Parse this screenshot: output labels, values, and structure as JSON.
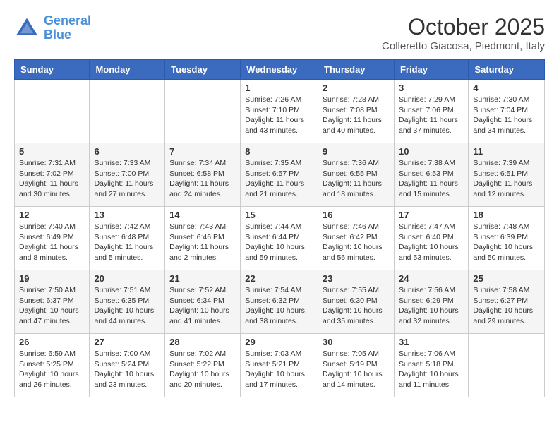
{
  "header": {
    "logo_line1": "General",
    "logo_line2": "Blue",
    "title": "October 2025",
    "subtitle": "Colleretto Giacosa, Piedmont, Italy"
  },
  "weekdays": [
    "Sunday",
    "Monday",
    "Tuesday",
    "Wednesday",
    "Thursday",
    "Friday",
    "Saturday"
  ],
  "weeks": [
    [
      {
        "day": "",
        "info": ""
      },
      {
        "day": "",
        "info": ""
      },
      {
        "day": "",
        "info": ""
      },
      {
        "day": "1",
        "info": "Sunrise: 7:26 AM\nSunset: 7:10 PM\nDaylight: 11 hours\nand 43 minutes."
      },
      {
        "day": "2",
        "info": "Sunrise: 7:28 AM\nSunset: 7:08 PM\nDaylight: 11 hours\nand 40 minutes."
      },
      {
        "day": "3",
        "info": "Sunrise: 7:29 AM\nSunset: 7:06 PM\nDaylight: 11 hours\nand 37 minutes."
      },
      {
        "day": "4",
        "info": "Sunrise: 7:30 AM\nSunset: 7:04 PM\nDaylight: 11 hours\nand 34 minutes."
      }
    ],
    [
      {
        "day": "5",
        "info": "Sunrise: 7:31 AM\nSunset: 7:02 PM\nDaylight: 11 hours\nand 30 minutes."
      },
      {
        "day": "6",
        "info": "Sunrise: 7:33 AM\nSunset: 7:00 PM\nDaylight: 11 hours\nand 27 minutes."
      },
      {
        "day": "7",
        "info": "Sunrise: 7:34 AM\nSunset: 6:58 PM\nDaylight: 11 hours\nand 24 minutes."
      },
      {
        "day": "8",
        "info": "Sunrise: 7:35 AM\nSunset: 6:57 PM\nDaylight: 11 hours\nand 21 minutes."
      },
      {
        "day": "9",
        "info": "Sunrise: 7:36 AM\nSunset: 6:55 PM\nDaylight: 11 hours\nand 18 minutes."
      },
      {
        "day": "10",
        "info": "Sunrise: 7:38 AM\nSunset: 6:53 PM\nDaylight: 11 hours\nand 15 minutes."
      },
      {
        "day": "11",
        "info": "Sunrise: 7:39 AM\nSunset: 6:51 PM\nDaylight: 11 hours\nand 12 minutes."
      }
    ],
    [
      {
        "day": "12",
        "info": "Sunrise: 7:40 AM\nSunset: 6:49 PM\nDaylight: 11 hours\nand 8 minutes."
      },
      {
        "day": "13",
        "info": "Sunrise: 7:42 AM\nSunset: 6:48 PM\nDaylight: 11 hours\nand 5 minutes."
      },
      {
        "day": "14",
        "info": "Sunrise: 7:43 AM\nSunset: 6:46 PM\nDaylight: 11 hours\nand 2 minutes."
      },
      {
        "day": "15",
        "info": "Sunrise: 7:44 AM\nSunset: 6:44 PM\nDaylight: 10 hours\nand 59 minutes."
      },
      {
        "day": "16",
        "info": "Sunrise: 7:46 AM\nSunset: 6:42 PM\nDaylight: 10 hours\nand 56 minutes."
      },
      {
        "day": "17",
        "info": "Sunrise: 7:47 AM\nSunset: 6:40 PM\nDaylight: 10 hours\nand 53 minutes."
      },
      {
        "day": "18",
        "info": "Sunrise: 7:48 AM\nSunset: 6:39 PM\nDaylight: 10 hours\nand 50 minutes."
      }
    ],
    [
      {
        "day": "19",
        "info": "Sunrise: 7:50 AM\nSunset: 6:37 PM\nDaylight: 10 hours\nand 47 minutes."
      },
      {
        "day": "20",
        "info": "Sunrise: 7:51 AM\nSunset: 6:35 PM\nDaylight: 10 hours\nand 44 minutes."
      },
      {
        "day": "21",
        "info": "Sunrise: 7:52 AM\nSunset: 6:34 PM\nDaylight: 10 hours\nand 41 minutes."
      },
      {
        "day": "22",
        "info": "Sunrise: 7:54 AM\nSunset: 6:32 PM\nDaylight: 10 hours\nand 38 minutes."
      },
      {
        "day": "23",
        "info": "Sunrise: 7:55 AM\nSunset: 6:30 PM\nDaylight: 10 hours\nand 35 minutes."
      },
      {
        "day": "24",
        "info": "Sunrise: 7:56 AM\nSunset: 6:29 PM\nDaylight: 10 hours\nand 32 minutes."
      },
      {
        "day": "25",
        "info": "Sunrise: 7:58 AM\nSunset: 6:27 PM\nDaylight: 10 hours\nand 29 minutes."
      }
    ],
    [
      {
        "day": "26",
        "info": "Sunrise: 6:59 AM\nSunset: 5:25 PM\nDaylight: 10 hours\nand 26 minutes."
      },
      {
        "day": "27",
        "info": "Sunrise: 7:00 AM\nSunset: 5:24 PM\nDaylight: 10 hours\nand 23 minutes."
      },
      {
        "day": "28",
        "info": "Sunrise: 7:02 AM\nSunset: 5:22 PM\nDaylight: 10 hours\nand 20 minutes."
      },
      {
        "day": "29",
        "info": "Sunrise: 7:03 AM\nSunset: 5:21 PM\nDaylight: 10 hours\nand 17 minutes."
      },
      {
        "day": "30",
        "info": "Sunrise: 7:05 AM\nSunset: 5:19 PM\nDaylight: 10 hours\nand 14 minutes."
      },
      {
        "day": "31",
        "info": "Sunrise: 7:06 AM\nSunset: 5:18 PM\nDaylight: 10 hours\nand 11 minutes."
      },
      {
        "day": "",
        "info": ""
      }
    ]
  ]
}
